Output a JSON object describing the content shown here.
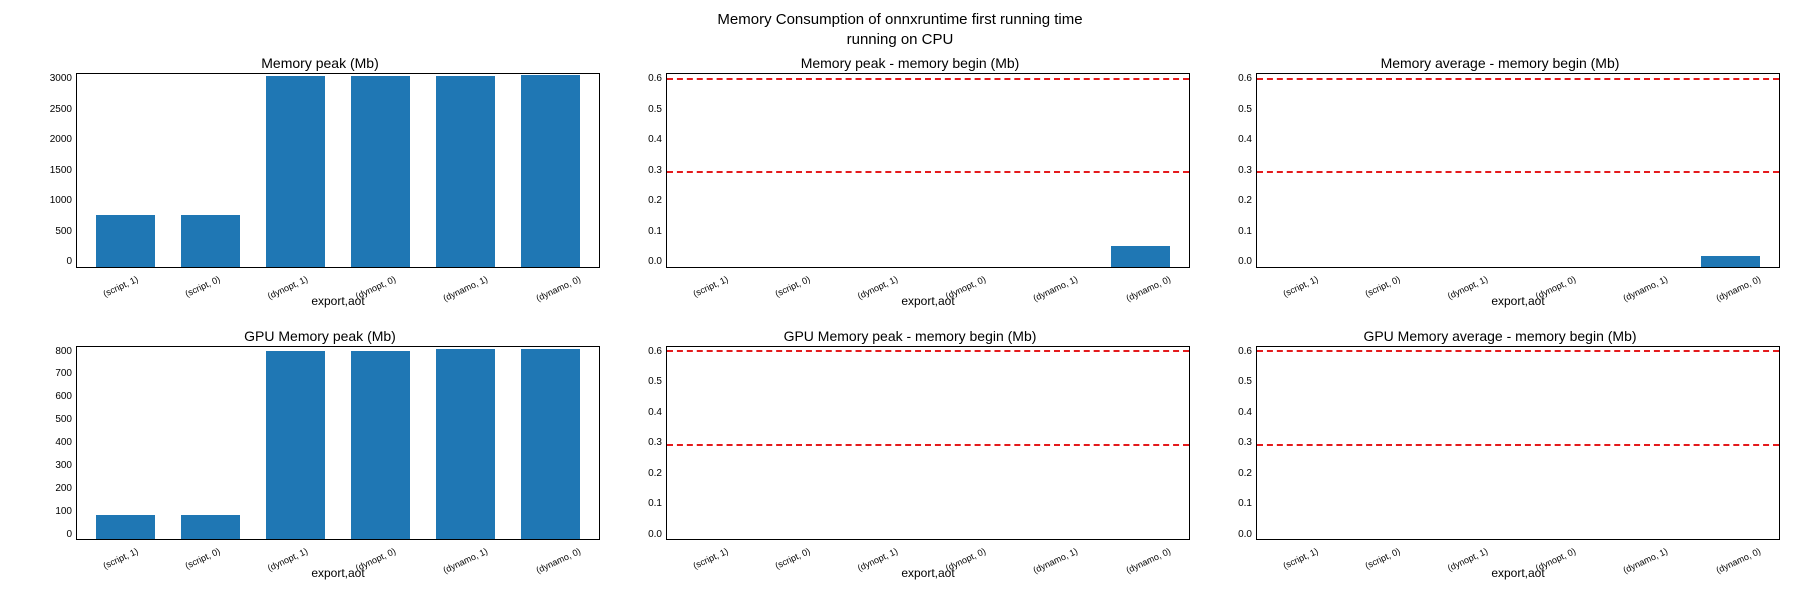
{
  "suptitle_line1": "Memory Consumption of onnxruntime first running time",
  "suptitle_line2": "running on CPU",
  "chart_data": [
    {
      "type": "bar",
      "title": "Memory peak (Mb)",
      "xlabel": "export,aot",
      "ylabel": "",
      "categories": [
        "(script, 1)",
        "(script, 0)",
        "(dynopt, 1)",
        "(dynopt, 0)",
        "(dynamo, 1)",
        "(dynamo, 0)"
      ],
      "values": [
        830,
        830,
        3060,
        3060,
        3070,
        3080
      ],
      "ylim": [
        0,
        3100
      ],
      "yticks": [
        0,
        500,
        1000,
        1500,
        2000,
        2500,
        3000
      ],
      "hlines": []
    },
    {
      "type": "bar",
      "title": "Memory peak - memory begin (Mb)",
      "xlabel": "export,aot",
      "ylabel": "",
      "categories": [
        "(script, 1)",
        "(script, 0)",
        "(dynopt, 1)",
        "(dynopt, 0)",
        "(dynamo, 1)",
        "(dynamo, 0)"
      ],
      "values": [
        0,
        0,
        0,
        0,
        0,
        0.07
      ],
      "ylim": [
        0,
        0.65
      ],
      "yticks": [
        0.0,
        0.1,
        0.2,
        0.3,
        0.4,
        0.5,
        0.6
      ],
      "hlines": [
        0.315,
        0.63
      ]
    },
    {
      "type": "bar",
      "title": "Memory average - memory begin (Mb)",
      "xlabel": "export,aot",
      "ylabel": "",
      "categories": [
        "(script, 1)",
        "(script, 0)",
        "(dynopt, 1)",
        "(dynopt, 0)",
        "(dynamo, 1)",
        "(dynamo, 0)"
      ],
      "values": [
        0,
        0,
        0,
        0,
        0,
        0.035
      ],
      "ylim": [
        0,
        0.65
      ],
      "yticks": [
        0.0,
        0.1,
        0.2,
        0.3,
        0.4,
        0.5,
        0.6
      ],
      "hlines": [
        0.315,
        0.63
      ]
    },
    {
      "type": "bar",
      "title": "GPU Memory peak (Mb)",
      "xlabel": "export,aot",
      "ylabel": "",
      "categories": [
        "(script, 1)",
        "(script, 0)",
        "(dynopt, 1)",
        "(dynopt, 0)",
        "(dynamo, 1)",
        "(dynamo, 0)"
      ],
      "values": [
        100,
        100,
        780,
        780,
        790,
        790
      ],
      "ylim": [
        0,
        800
      ],
      "yticks": [
        0,
        100,
        200,
        300,
        400,
        500,
        600,
        700,
        800
      ],
      "hlines": []
    },
    {
      "type": "bar",
      "title": "GPU Memory peak - memory begin (Mb)",
      "xlabel": "export,aot",
      "ylabel": "",
      "categories": [
        "(script, 1)",
        "(script, 0)",
        "(dynopt, 1)",
        "(dynopt, 0)",
        "(dynamo, 1)",
        "(dynamo, 0)"
      ],
      "values": [
        0,
        0,
        0,
        0,
        0,
        0
      ],
      "ylim": [
        0,
        0.65
      ],
      "yticks": [
        0.0,
        0.1,
        0.2,
        0.3,
        0.4,
        0.5,
        0.6
      ],
      "hlines": [
        0.315,
        0.63
      ]
    },
    {
      "type": "bar",
      "title": "GPU Memory average - memory begin (Mb)",
      "xlabel": "export,aot",
      "ylabel": "",
      "categories": [
        "(script, 1)",
        "(script, 0)",
        "(dynopt, 1)",
        "(dynopt, 0)",
        "(dynamo, 1)",
        "(dynamo, 0)"
      ],
      "values": [
        0,
        0,
        0,
        0,
        0,
        0
      ],
      "ylim": [
        0,
        0.65
      ],
      "yticks": [
        0.0,
        0.1,
        0.2,
        0.3,
        0.4,
        0.5,
        0.6
      ],
      "hlines": [
        0.315,
        0.63
      ]
    }
  ]
}
